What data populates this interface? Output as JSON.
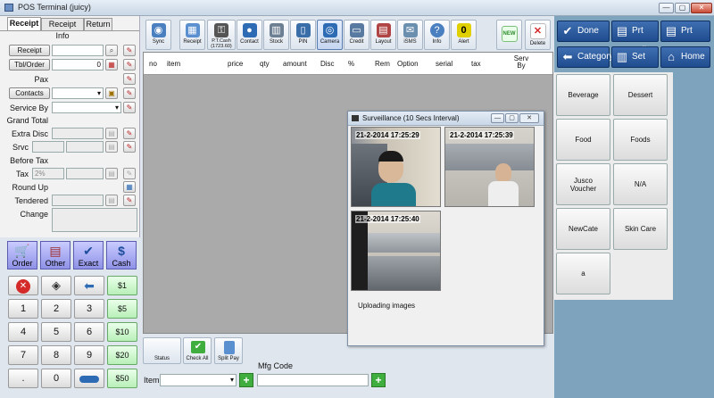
{
  "window": {
    "title": "POS Terminal (juicy)",
    "minimize": "—",
    "maximize": "▢",
    "close": "✕"
  },
  "tabs": [
    "Receipt",
    "Receipt Info",
    "Return"
  ],
  "receipt": {
    "receipt_button": "Receipt",
    "tbl_order_button": "Tbl/Order",
    "tbl_order_value": "0",
    "pax_label": "Pax",
    "contacts_button": "Contacts",
    "service_by_label": "Service By",
    "grand_total_label": "Grand Total",
    "extra_disc_label": "Extra Disc",
    "srvc_label": "Srvc",
    "before_tax_label": "Before Tax",
    "tax_label": "Tax",
    "tax_value": "2%",
    "round_up_label": "Round Up",
    "tendered_label": "Tendered",
    "change_label": "Change"
  },
  "payment_buttons": [
    "Order",
    "Other",
    "Exact",
    "Cash"
  ],
  "keypad": {
    "rows": [
      [
        "1",
        "2",
        "3",
        "$5"
      ],
      [
        "4",
        "5",
        "6",
        "$10"
      ],
      [
        "7",
        "8",
        "9",
        "$20"
      ],
      [
        ".",
        "0",
        "",
        "$50"
      ]
    ],
    "top_row_cash": "$1"
  },
  "toolbar": [
    {
      "label": "Sync",
      "icon": "eye-icon",
      "color": "#4a7fc0"
    },
    {
      "label": "Receipt",
      "icon": "grid-icon",
      "color": "#5a8fd0"
    },
    {
      "label": "P.T.Cash (1723.60)",
      "icon": "key-icon",
      "color": "#444"
    },
    {
      "label": "Contact",
      "icon": "person-icon",
      "color": "#2d6bb5"
    },
    {
      "label": "Stock",
      "icon": "box-icon",
      "color": "#6d7f92"
    },
    {
      "label": "PIN",
      "icon": "phone-icon",
      "color": "#3a6ea8"
    },
    {
      "label": "Camera",
      "icon": "camera-icon",
      "color": "#2d6bb5"
    },
    {
      "label": "Credit",
      "icon": "card-icon",
      "color": "#587aa0"
    },
    {
      "label": "Layout",
      "icon": "layout-icon",
      "color": "#b04444"
    },
    {
      "label": "iSMS",
      "icon": "sms-icon",
      "color": "#6b8faf"
    },
    {
      "label": "Info",
      "icon": "info-icon",
      "color": "#4a7fc0"
    },
    {
      "label": "Alert",
      "icon": "alert-icon",
      "color": "#d6c000"
    }
  ],
  "toolbar_alert_value": "0",
  "new_button": "",
  "new_badge": "NEW",
  "delete_button": "Delete",
  "table_columns": [
    "no",
    "item",
    "price",
    "qty",
    "amount",
    "Disc",
    "%",
    "Rem",
    "Option",
    "serial",
    "tax",
    "Serv By"
  ],
  "actions": [
    {
      "label": "Done",
      "icon": "check-icon"
    },
    {
      "label": "Prt Full",
      "icon": "printer-icon"
    },
    {
      "label": "Prt Item",
      "icon": "printer-icon"
    },
    {
      "label": "Category",
      "icon": "arrow-left-icon"
    },
    {
      "label": "Set",
      "icon": "basket-icon"
    },
    {
      "label": "Home",
      "icon": "home-icon"
    }
  ],
  "categories": [
    "Beverage",
    "Dessert",
    "Food",
    "Foods",
    "Jusco Voucher",
    "N/A",
    "NewCate",
    "Skin Care",
    "a"
  ],
  "surveillance": {
    "title": "Surveillance (10 Secs Interval)",
    "cams": [
      "21-2-2014 17:25:29",
      "21-2-2014 17:25:39",
      "21-2-2014 17:25:40"
    ],
    "status": "Uploading images"
  },
  "bottom_buttons": [
    "Status",
    "Check All",
    "Split Pay"
  ],
  "mfg_code_label": "Mfg Code",
  "item_label": "Item"
}
